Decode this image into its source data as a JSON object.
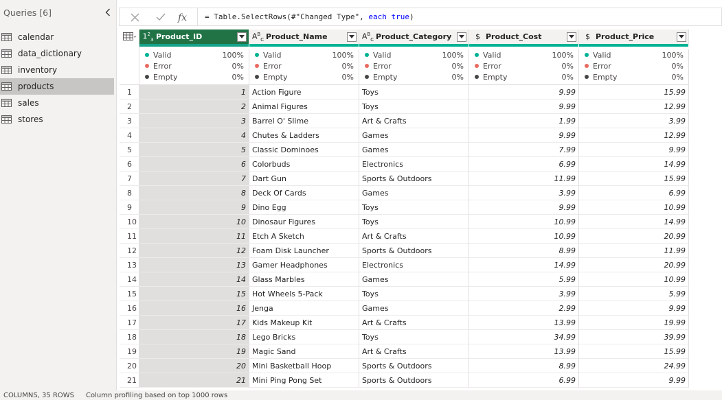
{
  "queries_pane": {
    "header": "Queries [6]",
    "items": [
      {
        "label": "calendar",
        "selected": false
      },
      {
        "label": "data_dictionary",
        "selected": false
      },
      {
        "label": "inventory",
        "selected": false
      },
      {
        "label": "products",
        "selected": true
      },
      {
        "label": "sales",
        "selected": false
      },
      {
        "label": "stores",
        "selected": false
      }
    ]
  },
  "formula_bar": {
    "prefix": "= Table.SelectRows(#\"Changed Type\", ",
    "kw1": "each",
    "kw2": "true",
    "suffix": ")"
  },
  "columns": [
    {
      "name": "Product_ID",
      "type_icon": "123",
      "selected": true,
      "numeric": true
    },
    {
      "name": "Product_Name",
      "type_icon": "ABC",
      "selected": false,
      "numeric": false
    },
    {
      "name": "Product_Category",
      "type_icon": "ABC",
      "selected": false,
      "numeric": false
    },
    {
      "name": "Product_Cost",
      "type_icon": "$",
      "selected": false,
      "numeric": true
    },
    {
      "name": "Product_Price",
      "type_icon": "$",
      "selected": false,
      "numeric": true
    }
  ],
  "profile_labels": {
    "valid": "Valid",
    "error": "Error",
    "empty": "Empty"
  },
  "profiles": [
    {
      "valid": "100%",
      "error": "0%",
      "empty": "0%"
    },
    {
      "valid": "100%",
      "error": "0%",
      "empty": "0%"
    },
    {
      "valid": "100%",
      "error": "0%",
      "empty": "0%"
    },
    {
      "valid": "100%",
      "error": "0%",
      "empty": "0%"
    },
    {
      "valid": "100%",
      "error": "0%",
      "empty": "0%"
    }
  ],
  "rows": [
    [
      "1",
      "1",
      "Action Figure",
      "Toys",
      "9.99",
      "15.99"
    ],
    [
      "2",
      "2",
      "Animal Figures",
      "Toys",
      "9.99",
      "12.99"
    ],
    [
      "3",
      "3",
      "Barrel O' Slime",
      "Art & Crafts",
      "1.99",
      "3.99"
    ],
    [
      "4",
      "4",
      "Chutes & Ladders",
      "Games",
      "9.99",
      "12.99"
    ],
    [
      "5",
      "5",
      "Classic Dominoes",
      "Games",
      "7.99",
      "9.99"
    ],
    [
      "6",
      "6",
      "Colorbuds",
      "Electronics",
      "6.99",
      "14.99"
    ],
    [
      "7",
      "7",
      "Dart Gun",
      "Sports & Outdoors",
      "11.99",
      "15.99"
    ],
    [
      "8",
      "8",
      "Deck Of Cards",
      "Games",
      "3.99",
      "6.99"
    ],
    [
      "9",
      "9",
      "Dino Egg",
      "Toys",
      "9.99",
      "10.99"
    ],
    [
      "10",
      "10",
      "Dinosaur Figures",
      "Toys",
      "10.99",
      "14.99"
    ],
    [
      "11",
      "11",
      "Etch A Sketch",
      "Art & Crafts",
      "10.99",
      "20.99"
    ],
    [
      "12",
      "12",
      "Foam Disk Launcher",
      "Sports & Outdoors",
      "8.99",
      "11.99"
    ],
    [
      "13",
      "13",
      "Gamer Headphones",
      "Electronics",
      "14.99",
      "20.99"
    ],
    [
      "14",
      "14",
      "Glass Marbles",
      "Games",
      "5.99",
      "10.99"
    ],
    [
      "15",
      "15",
      "Hot Wheels 5-Pack",
      "Toys",
      "3.99",
      "5.99"
    ],
    [
      "16",
      "16",
      "Jenga",
      "Games",
      "2.99",
      "9.99"
    ],
    [
      "17",
      "17",
      "Kids Makeup Kit",
      "Art & Crafts",
      "13.99",
      "19.99"
    ],
    [
      "18",
      "18",
      "Lego Bricks",
      "Toys",
      "34.99",
      "39.99"
    ],
    [
      "19",
      "19",
      "Magic Sand",
      "Art & Crafts",
      "13.99",
      "15.99"
    ],
    [
      "20",
      "20",
      "Mini Basketball Hoop",
      "Sports & Outdoors",
      "8.99",
      "24.99"
    ],
    [
      "21",
      "21",
      "Mini Ping Pong Set",
      "Sports & Outdoors",
      "6.99",
      "9.99"
    ]
  ],
  "status_bar": {
    "summary": "COLUMNS, 35 ROWS",
    "profiling": "Column profiling based on top 1000 rows"
  },
  "colors": {
    "selected_header": "#217346",
    "valid": "#00b294",
    "error": "#e86a5f",
    "empty": "#484644"
  }
}
